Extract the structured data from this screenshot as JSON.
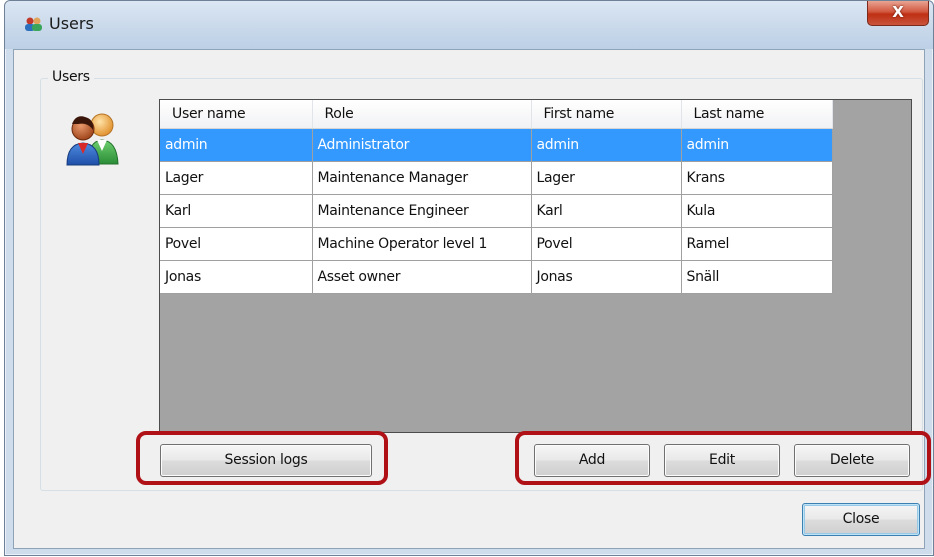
{
  "window": {
    "title": "Users",
    "close_glyph": "X"
  },
  "group": {
    "label": "Users"
  },
  "icons": {
    "app": "users-app-icon",
    "group": "users-group-icon"
  },
  "table": {
    "columns": [
      "User name",
      "Role",
      "First name",
      "Last name"
    ],
    "rows": [
      [
        "admin",
        "Administrator",
        "admin",
        "admin"
      ],
      [
        "Lager",
        "Maintenance Manager",
        "Lager",
        "Krans"
      ],
      [
        "Karl",
        "Maintenance Engineer",
        "Karl",
        "Kula"
      ],
      [
        "Povel",
        "Machine Operator level 1",
        "Povel",
        "Ramel"
      ],
      [
        "Jonas",
        "Asset owner",
        "Jonas",
        "Snäll"
      ]
    ],
    "selected_row": 0
  },
  "buttons": {
    "session_logs": "Session logs",
    "add": "Add",
    "edit": "Edit",
    "delete": "Delete",
    "close": "Close"
  },
  "colors": {
    "selection": "#3399ff",
    "highlight": "#b01116"
  }
}
